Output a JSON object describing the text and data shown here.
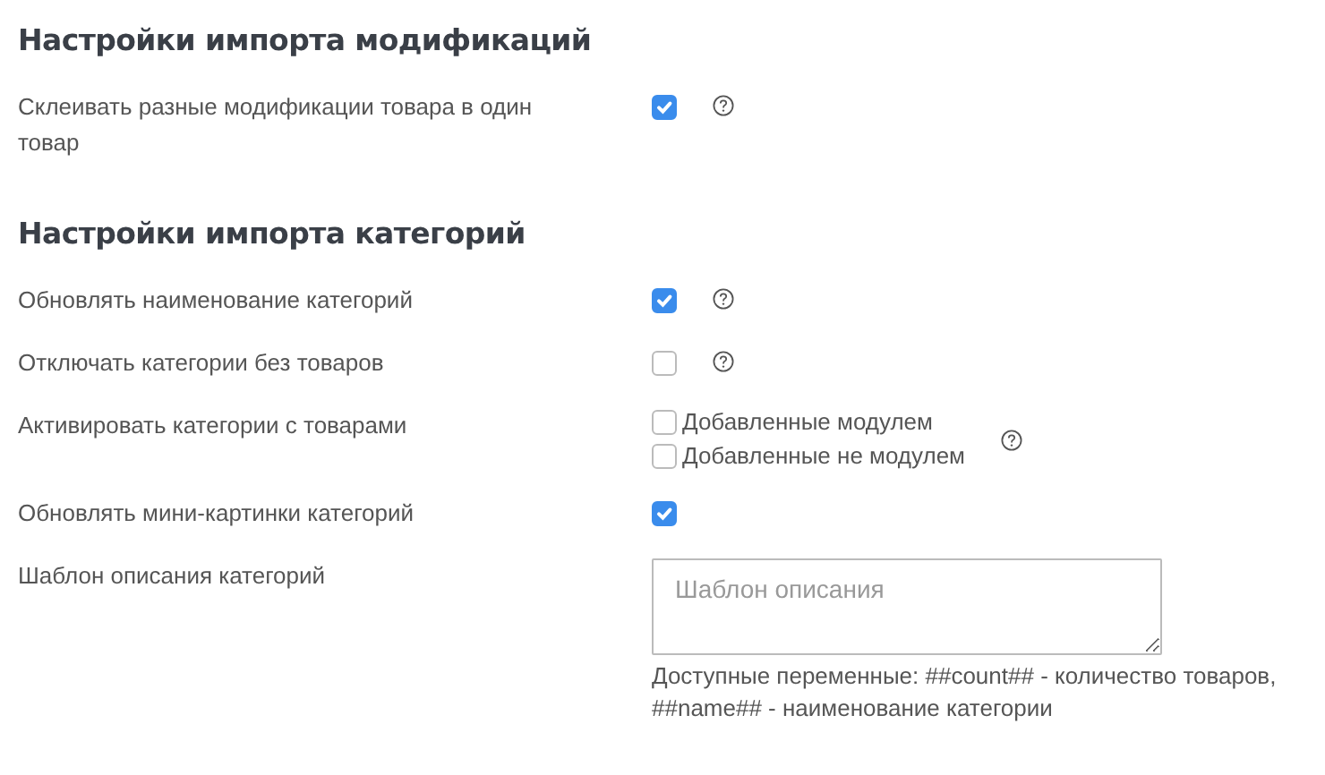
{
  "sections": [
    {
      "title": "Настройки импорта модификаций",
      "rows": [
        {
          "kind": "checkbox",
          "label": "Склеивать разные модификации товара в один товар",
          "checked": true,
          "help": true
        }
      ]
    },
    {
      "title": "Настройки импорта категорий",
      "rows": [
        {
          "kind": "checkbox",
          "label": "Обновлять наименование категорий",
          "checked": true,
          "help": true
        },
        {
          "kind": "checkbox",
          "label": "Отключать категории без товаров",
          "checked": false,
          "help": true
        },
        {
          "kind": "group",
          "label": "Активировать категории с товарами",
          "help": true,
          "options": [
            {
              "label": "Добавленные модулем",
              "checked": false
            },
            {
              "label": "Добавленные не модулем",
              "checked": false
            }
          ]
        },
        {
          "kind": "checkbox",
          "label": "Обновлять мини-картинки категорий",
          "checked": true,
          "help": false
        },
        {
          "kind": "textarea",
          "label": "Шаблон описания категорий",
          "placeholder": "Шаблон описания",
          "hint": "Доступные переменные: ##count## - количество товаров, ##name## - наименование категории",
          "help": false
        }
      ]
    }
  ]
}
